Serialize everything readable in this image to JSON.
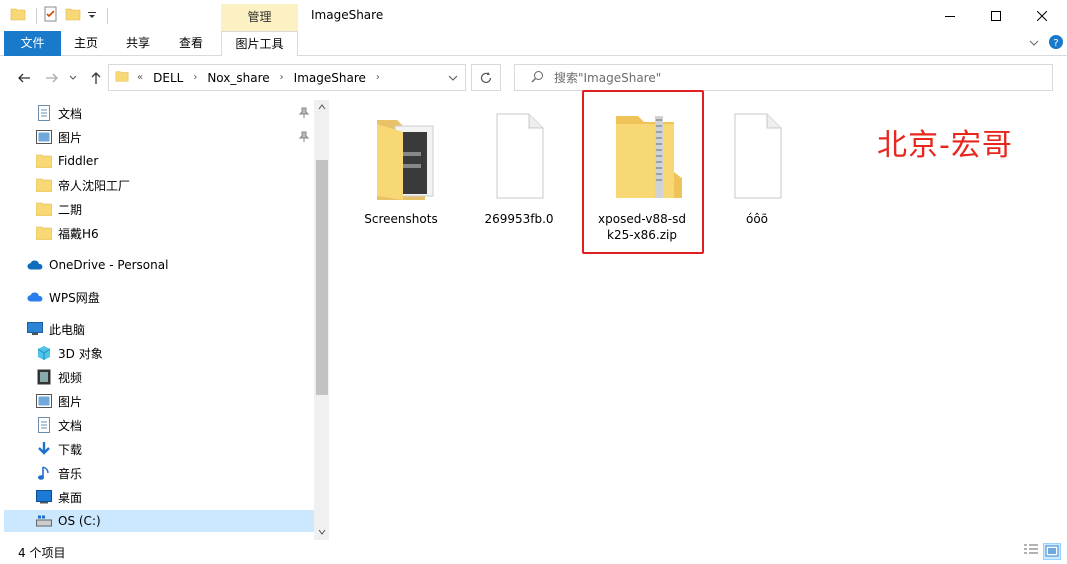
{
  "window": {
    "title": "ImageShare",
    "context_tab": "管理",
    "controls": {
      "minimize": "minimize-icon",
      "maximize": "maximize-icon",
      "close": "close-icon"
    }
  },
  "ribbon": {
    "tabs": [
      "文件",
      "主页",
      "共享",
      "查看",
      "图片工具"
    ]
  },
  "address": {
    "overflow": "«",
    "crumbs": [
      "DELL",
      "Nox_share",
      "ImageShare"
    ],
    "search_placeholder": "搜索\"ImageShare\""
  },
  "sidebar": {
    "quick_access": [
      {
        "label": "文档",
        "icon": "document-icon",
        "pinned": true
      },
      {
        "label": "图片",
        "icon": "picture-icon",
        "pinned": true
      },
      {
        "label": "Fiddler",
        "icon": "folder-icon"
      },
      {
        "label": "帝人沈阳工厂",
        "icon": "folder-icon"
      },
      {
        "label": "二期",
        "icon": "folder-icon"
      },
      {
        "label": "福戴H6",
        "icon": "folder-icon"
      }
    ],
    "onedrive": "OneDrive - Personal",
    "wps": "WPS网盘",
    "this_pc": "此电脑",
    "pc_items": [
      {
        "label": "3D 对象",
        "icon": "cube-icon"
      },
      {
        "label": "视频",
        "icon": "video-icon"
      },
      {
        "label": "图片",
        "icon": "picture-icon"
      },
      {
        "label": "文档",
        "icon": "document-icon"
      },
      {
        "label": "下载",
        "icon": "download-icon"
      },
      {
        "label": "音乐",
        "icon": "music-icon"
      },
      {
        "label": "桌面",
        "icon": "desktop-icon"
      },
      {
        "label": "OS (C:)",
        "icon": "drive-icon",
        "selected": true
      }
    ]
  },
  "files": [
    {
      "name": "Screenshots",
      "icon": "folder-icon"
    },
    {
      "name": "269953fb.0",
      "icon": "file-icon"
    },
    {
      "name": "xposed-v88-sdk25-x86.zip",
      "line1": "xposed-v88-sd",
      "line2": "k25-x86.zip",
      "icon": "zip-folder-icon",
      "highlighted": true
    },
    {
      "name": "óôõ",
      "icon": "file-icon"
    }
  ],
  "watermark": "北京-宏哥",
  "status": {
    "item_count": "4 个项目"
  },
  "colors": {
    "accent": "#1979ca",
    "context_tab": "#fbf1c2",
    "selection": "#cce8ff",
    "highlight_box": "#e02020",
    "watermark": "#e8261e"
  }
}
